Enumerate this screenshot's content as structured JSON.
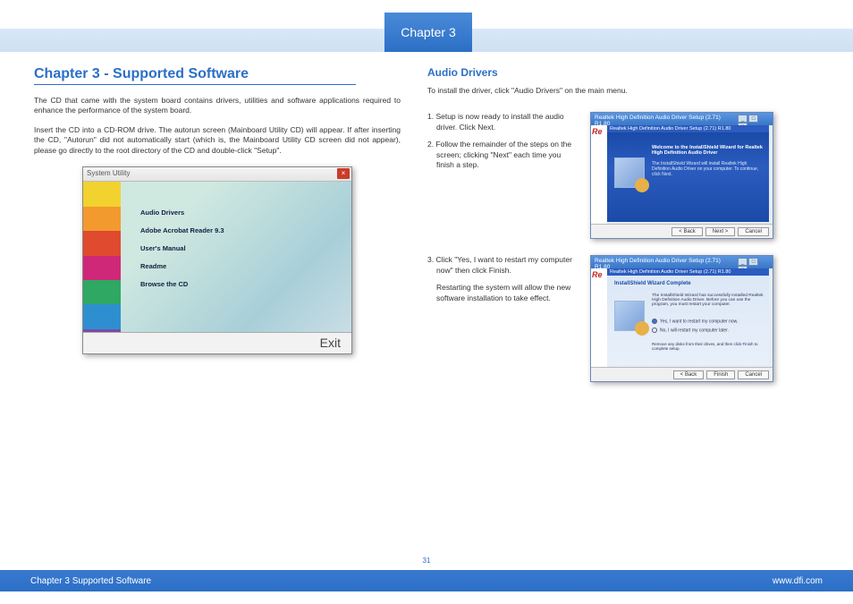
{
  "chapter_tab": "Chapter 3",
  "page_number": "31",
  "footer_left": "Chapter 3 Supported Software",
  "footer_right": "www.dfi.com",
  "left": {
    "title": "Chapter 3 - Supported Software",
    "para1": "The CD that came with the system board contains drivers, utilities and software applications required to enhance the performance of the system board.",
    "para2": "Insert the CD into a CD-ROM drive. The autorun screen (Mainboard Utility CD) will appear. If after inserting the CD, \"Autorun\" did not automatically start (which is, the Mainboard Utility CD screen did not appear), please go directly to the root directory of the CD and double-click \"Setup\"."
  },
  "sys_util": {
    "title": "System Utility",
    "menu": [
      "Audio Drivers",
      "Adobe Acrobat Reader 9.3",
      "User's Manual",
      "Readme",
      "Browse the CD"
    ],
    "exit": "Exit",
    "stripes": [
      "#f2d22e",
      "#f29a2e",
      "#e04a2e",
      "#d02878",
      "#2ea862",
      "#2e8fd0",
      "#7c4aa8"
    ]
  },
  "right": {
    "title": "Audio Drivers",
    "intro": "To install the driver, click \"Audio Drivers\" on the main menu.",
    "step1": "1. Setup is now ready to install the audio driver. Click Next.",
    "step2": "2. Follow the remainder of the steps on the screen; clicking \"Next\" each time you finish a step.",
    "step3": "3. Click \"Yes, I want to restart my computer now\" then click Finish.",
    "step3b": "Restarting the system will allow the new software installation to take effect."
  },
  "installer1": {
    "title": "Realtek High Definition Audio Driver Setup (2.71) R1.80",
    "banner": "Realtek High Definition Audio Driver Setup (2.71) R1.80",
    "heading": "Welcome to the InstallShield Wizard for Realtek High Definition Audio Driver",
    "body": "The InstallShield Wizard will install Realtek High Definition Audio Driver on your computer. To continue, click Next.",
    "btn_back": "< Back",
    "btn_next": "Next >",
    "btn_cancel": "Cancel",
    "re": "Re"
  },
  "installer2": {
    "title": "Realtek High Definition Audio Driver Setup (2.71) R1.80",
    "banner": "Realtek High Definition Audio Driver Setup (2.71) R1.80",
    "heading": "InstallShield Wizard Complete",
    "body": "The InstallShield Wizard has successfully installed Realtek High Definition Audio Driver. Before you can use the program, you must restart your computer.",
    "radio1": "Yes, I want to restart my computer now.",
    "radio2": "No, I will restart my computer later.",
    "note": "Remove any disks from their drives, and then click Finish to complete setup.",
    "btn_back": "< Back",
    "btn_finish": "Finish",
    "btn_cancel": "Cancel",
    "re": "Re"
  }
}
